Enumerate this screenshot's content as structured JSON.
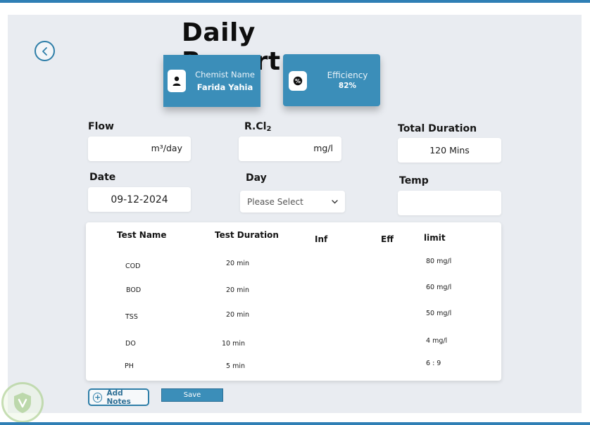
{
  "header": {
    "title": "Daily Report"
  },
  "icons": {
    "back": "chevron-left-icon",
    "person": "person-icon",
    "percent": "percent-icon",
    "plus": "plus-circle-icon",
    "dropdown": "chevron-down-icon"
  },
  "colors": {
    "accent": "#3b8eb9",
    "frame": "#2f7fb5",
    "background": "#e9ecf1"
  },
  "cards": {
    "chemist": {
      "label": "Chemist Name",
      "value": "Farida Yahia"
    },
    "efficiency": {
      "label": "Efficiency",
      "value": "82%"
    }
  },
  "form": {
    "flow": {
      "label": "Flow",
      "unit": "m³/day",
      "value": ""
    },
    "rcl2": {
      "label": "R.Cl",
      "label_sub": "2",
      "unit": "mg/l",
      "value": ""
    },
    "total_duration": {
      "label": "Total Duration",
      "value": "120 Mins"
    },
    "date": {
      "label": "Date",
      "value": "09-12-2024"
    },
    "day": {
      "label": "Day",
      "selected": "Please Select"
    },
    "temp": {
      "label": "Temp",
      "value": ""
    }
  },
  "table": {
    "headers": {
      "test_name": "Test Name",
      "test_duration": "Test Duration",
      "inf": "Inf",
      "eff": "Eff",
      "limit": "limit"
    },
    "rows": [
      {
        "name": "COD",
        "duration": "20 min",
        "limit": "80 mg/l"
      },
      {
        "name": "BOD",
        "duration": "20 min",
        "limit": "60 mg/l"
      },
      {
        "name": "TSS",
        "duration": "20 min",
        "limit": "50 mg/l"
      },
      {
        "name": "DO",
        "duration": "10 min",
        "limit": "4 mg/l"
      },
      {
        "name": "PH",
        "duration": "5 min",
        "limit": "6 : 9"
      }
    ]
  },
  "actions": {
    "add_notes": "Add Notes",
    "save": "Save"
  }
}
